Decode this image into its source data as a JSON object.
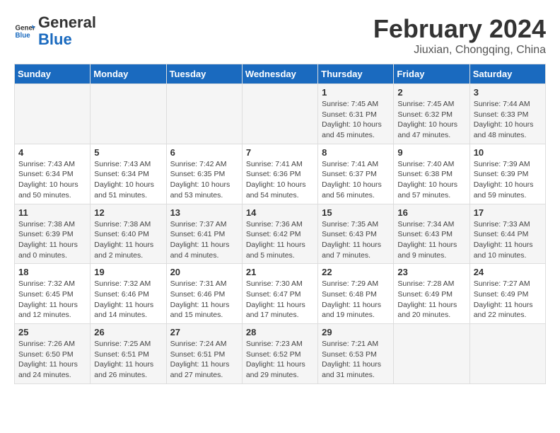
{
  "logo": {
    "line1": "General",
    "line2": "Blue"
  },
  "title": "February 2024",
  "subtitle": "Jiuxian, Chongqing, China",
  "days_of_week": [
    "Sunday",
    "Monday",
    "Tuesday",
    "Wednesday",
    "Thursday",
    "Friday",
    "Saturday"
  ],
  "weeks": [
    [
      {
        "day": "",
        "info": ""
      },
      {
        "day": "",
        "info": ""
      },
      {
        "day": "",
        "info": ""
      },
      {
        "day": "",
        "info": ""
      },
      {
        "day": "1",
        "info": "Sunrise: 7:45 AM\nSunset: 6:31 PM\nDaylight: 10 hours and 45 minutes."
      },
      {
        "day": "2",
        "info": "Sunrise: 7:45 AM\nSunset: 6:32 PM\nDaylight: 10 hours and 47 minutes."
      },
      {
        "day": "3",
        "info": "Sunrise: 7:44 AM\nSunset: 6:33 PM\nDaylight: 10 hours and 48 minutes."
      }
    ],
    [
      {
        "day": "4",
        "info": "Sunrise: 7:43 AM\nSunset: 6:34 PM\nDaylight: 10 hours and 50 minutes."
      },
      {
        "day": "5",
        "info": "Sunrise: 7:43 AM\nSunset: 6:34 PM\nDaylight: 10 hours and 51 minutes."
      },
      {
        "day": "6",
        "info": "Sunrise: 7:42 AM\nSunset: 6:35 PM\nDaylight: 10 hours and 53 minutes."
      },
      {
        "day": "7",
        "info": "Sunrise: 7:41 AM\nSunset: 6:36 PM\nDaylight: 10 hours and 54 minutes."
      },
      {
        "day": "8",
        "info": "Sunrise: 7:41 AM\nSunset: 6:37 PM\nDaylight: 10 hours and 56 minutes."
      },
      {
        "day": "9",
        "info": "Sunrise: 7:40 AM\nSunset: 6:38 PM\nDaylight: 10 hours and 57 minutes."
      },
      {
        "day": "10",
        "info": "Sunrise: 7:39 AM\nSunset: 6:39 PM\nDaylight: 10 hours and 59 minutes."
      }
    ],
    [
      {
        "day": "11",
        "info": "Sunrise: 7:38 AM\nSunset: 6:39 PM\nDaylight: 11 hours and 0 minutes."
      },
      {
        "day": "12",
        "info": "Sunrise: 7:38 AM\nSunset: 6:40 PM\nDaylight: 11 hours and 2 minutes."
      },
      {
        "day": "13",
        "info": "Sunrise: 7:37 AM\nSunset: 6:41 PM\nDaylight: 11 hours and 4 minutes."
      },
      {
        "day": "14",
        "info": "Sunrise: 7:36 AM\nSunset: 6:42 PM\nDaylight: 11 hours and 5 minutes."
      },
      {
        "day": "15",
        "info": "Sunrise: 7:35 AM\nSunset: 6:43 PM\nDaylight: 11 hours and 7 minutes."
      },
      {
        "day": "16",
        "info": "Sunrise: 7:34 AM\nSunset: 6:43 PM\nDaylight: 11 hours and 9 minutes."
      },
      {
        "day": "17",
        "info": "Sunrise: 7:33 AM\nSunset: 6:44 PM\nDaylight: 11 hours and 10 minutes."
      }
    ],
    [
      {
        "day": "18",
        "info": "Sunrise: 7:32 AM\nSunset: 6:45 PM\nDaylight: 11 hours and 12 minutes."
      },
      {
        "day": "19",
        "info": "Sunrise: 7:32 AM\nSunset: 6:46 PM\nDaylight: 11 hours and 14 minutes."
      },
      {
        "day": "20",
        "info": "Sunrise: 7:31 AM\nSunset: 6:46 PM\nDaylight: 11 hours and 15 minutes."
      },
      {
        "day": "21",
        "info": "Sunrise: 7:30 AM\nSunset: 6:47 PM\nDaylight: 11 hours and 17 minutes."
      },
      {
        "day": "22",
        "info": "Sunrise: 7:29 AM\nSunset: 6:48 PM\nDaylight: 11 hours and 19 minutes."
      },
      {
        "day": "23",
        "info": "Sunrise: 7:28 AM\nSunset: 6:49 PM\nDaylight: 11 hours and 20 minutes."
      },
      {
        "day": "24",
        "info": "Sunrise: 7:27 AM\nSunset: 6:49 PM\nDaylight: 11 hours and 22 minutes."
      }
    ],
    [
      {
        "day": "25",
        "info": "Sunrise: 7:26 AM\nSunset: 6:50 PM\nDaylight: 11 hours and 24 minutes."
      },
      {
        "day": "26",
        "info": "Sunrise: 7:25 AM\nSunset: 6:51 PM\nDaylight: 11 hours and 26 minutes."
      },
      {
        "day": "27",
        "info": "Sunrise: 7:24 AM\nSunset: 6:51 PM\nDaylight: 11 hours and 27 minutes."
      },
      {
        "day": "28",
        "info": "Sunrise: 7:23 AM\nSunset: 6:52 PM\nDaylight: 11 hours and 29 minutes."
      },
      {
        "day": "29",
        "info": "Sunrise: 7:21 AM\nSunset: 6:53 PM\nDaylight: 11 hours and 31 minutes."
      },
      {
        "day": "",
        "info": ""
      },
      {
        "day": "",
        "info": ""
      }
    ]
  ]
}
